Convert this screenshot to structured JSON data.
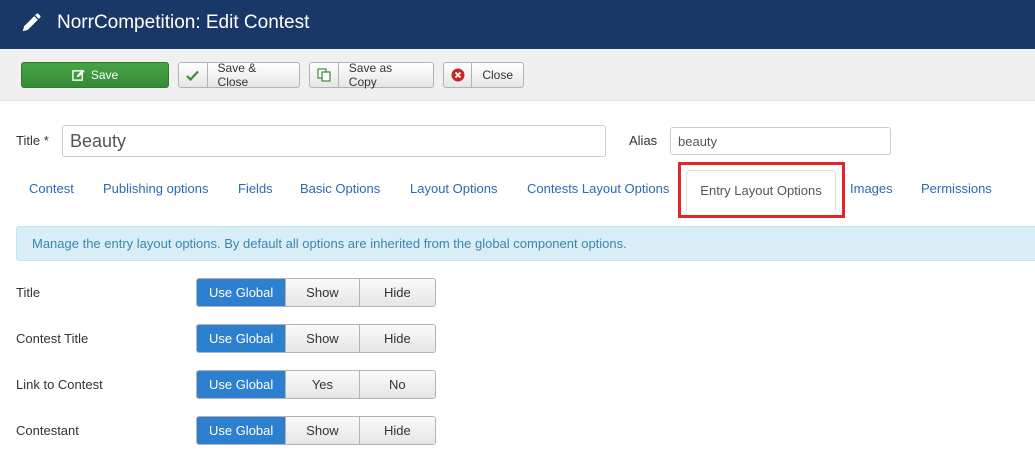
{
  "header": {
    "title": "NorrCompetition: Edit Contest",
    "icon": "pencil-icon",
    "bg_color": "#1a3867"
  },
  "toolbar": {
    "save": {
      "label": "Save",
      "icon": "edit-icon",
      "color": "#46a546"
    },
    "save_close": {
      "label": "Save & Close",
      "icon": "check-icon"
    },
    "save_copy": {
      "label": "Save as Copy",
      "icon": "copy-icon"
    },
    "close": {
      "label": "Close",
      "icon": "close-circle-icon"
    }
  },
  "form": {
    "title_label": "Title *",
    "title_value": "Beauty",
    "alias_label": "Alias",
    "alias_value": "beauty"
  },
  "tabs": [
    {
      "label": "Contest"
    },
    {
      "label": "Publishing options"
    },
    {
      "label": "Fields"
    },
    {
      "label": "Basic Options"
    },
    {
      "label": "Layout Options"
    },
    {
      "label": "Contests Layout Options"
    },
    {
      "label": "Entry Layout Options",
      "active": true
    },
    {
      "label": "Images"
    },
    {
      "label": "Permissions"
    }
  ],
  "info_message": "Manage the entry layout options. By default all options are inherited from the global component options.",
  "options": [
    {
      "label": "Title",
      "choices": [
        "Use Global",
        "Show",
        "Hide"
      ],
      "selected": "Use Global"
    },
    {
      "label": "Contest Title",
      "choices": [
        "Use Global",
        "Show",
        "Hide"
      ],
      "selected": "Use Global"
    },
    {
      "label": "Link to Contest",
      "choices": [
        "Use Global",
        "Yes",
        "No"
      ],
      "selected": "Use Global"
    },
    {
      "label": "Contestant",
      "choices": [
        "Use Global",
        "Show",
        "Hide"
      ],
      "selected": "Use Global"
    }
  ]
}
